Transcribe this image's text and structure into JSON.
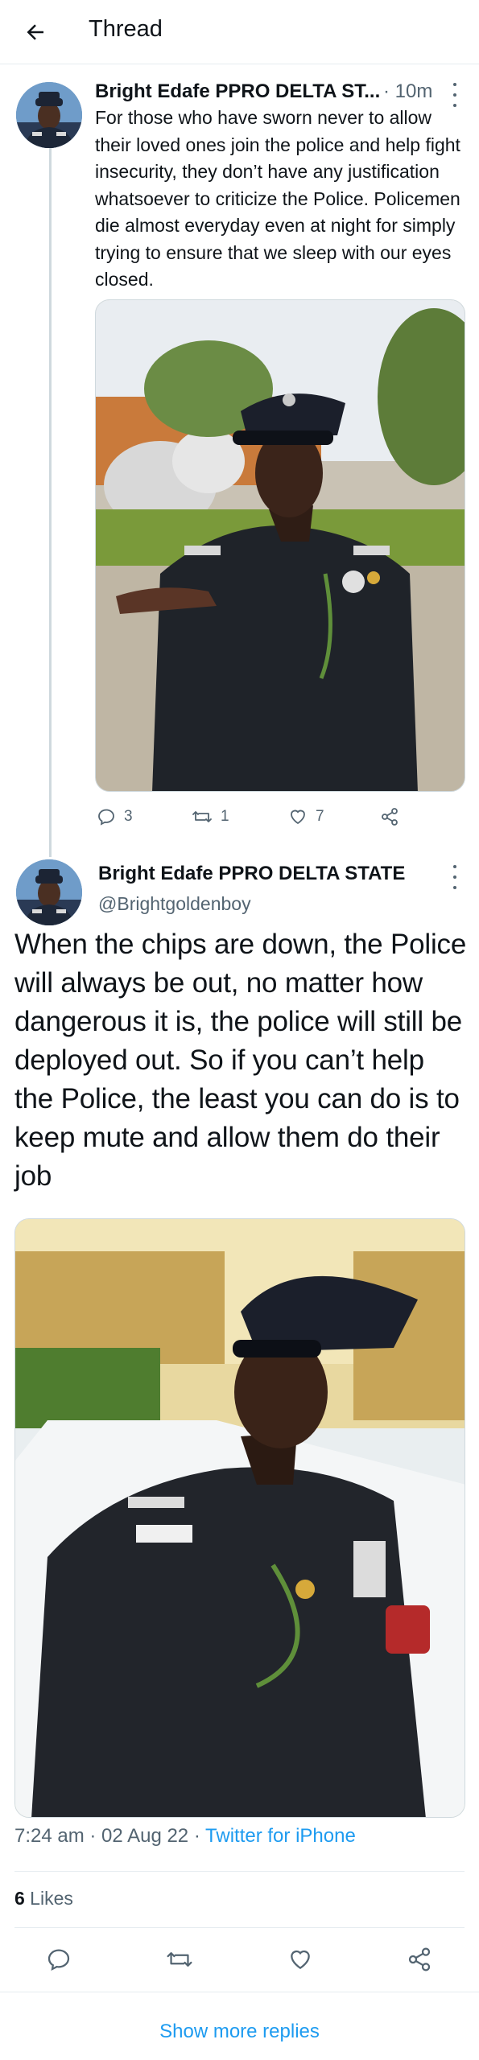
{
  "header": {
    "title": "Thread"
  },
  "tweet1": {
    "author": "Bright Edafe PPRO DELTA ST...",
    "time": "· 10m",
    "text": "For those who have sworn never to allow their loved ones join the police and help fight insecurity, they don’t have any justification whatsoever to criticize the Police. Policemen die almost everyday even at night for simply trying to ensure that we sleep with our eyes closed.",
    "replies": "3",
    "retweets": "1",
    "likes": "7"
  },
  "tweet2": {
    "author": "Bright Edafe PPRO DELTA STATE",
    "handle": "@Brightgoldenboy",
    "text": "When the chips are down, the Police will always be out, no matter how dangerous it is, the police will still be deployed out. So if you can’t help the Police, the least you can do is to keep mute and allow them do their job",
    "timestamp": "7:24 am · 02 Aug 22 · ",
    "source": "Twitter for iPhone",
    "like_count": "6",
    "like_label": " Likes"
  },
  "show_more": "Show more replies",
  "colors": {
    "accent": "#1d9bf0",
    "text": "#0f1419",
    "muted": "#536471",
    "border": "#e6ecf0"
  },
  "icons": [
    "back-arrow-icon",
    "more-icon",
    "reply-icon",
    "retweet-icon",
    "like-icon",
    "share-icon"
  ]
}
